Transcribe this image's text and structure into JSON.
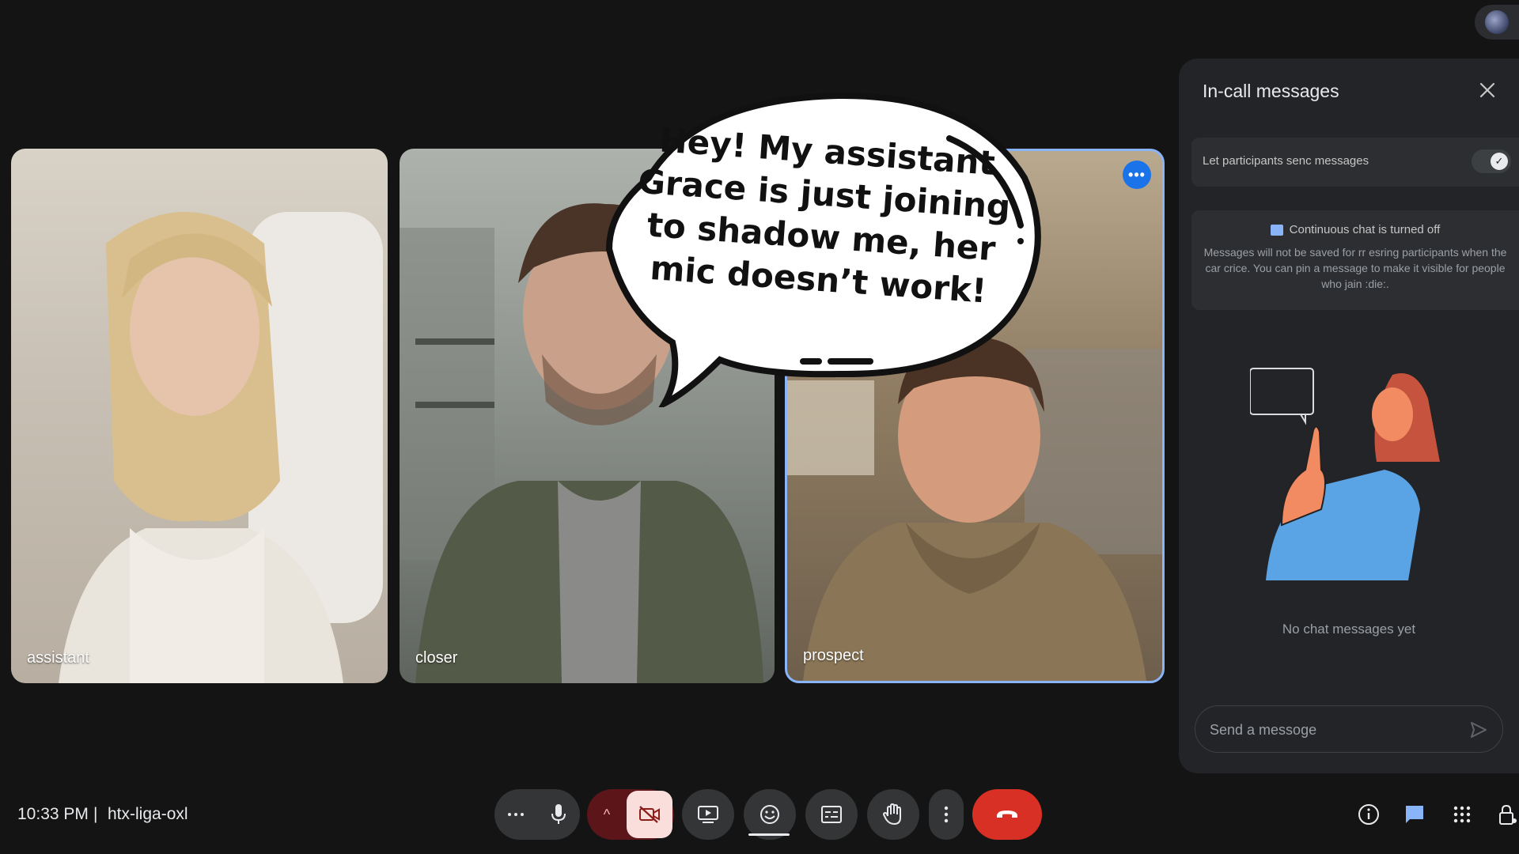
{
  "participants": [
    {
      "name": "assistant"
    },
    {
      "name": "closer"
    },
    {
      "name": "prospect"
    }
  ],
  "speech_bubble": {
    "text": "Hey! My assistant Grace is just joining to shadow me, her mic doesn’t work!"
  },
  "panel": {
    "title": "In-call messages",
    "toggle_label": "Let participants senc messages",
    "toggle_on": true,
    "info_heading": "Continuous chat is turned off",
    "info_body": "Messages will not be saved for rr esring participants when the car crice. You can pin a message to make it visible for people who jain :die:.",
    "empty_text": "No chat messages yet",
    "input_placeholder": "Send a messoge"
  },
  "bottom": {
    "time": "10:33 PM",
    "separator": "|",
    "meeting_code": "htx-liga-oxl"
  },
  "colors": {
    "background": "#141414",
    "panel": "#232427",
    "accent_blue": "#8ab4f8",
    "end_call": "#d93025",
    "camera_off_bg": "#f9dedc"
  },
  "icons": {
    "more_options": "ellipsis-horizontal-icon",
    "mic": "mic-icon",
    "camera_off": "camera-off-icon",
    "present": "present-screen-icon",
    "emoji": "emoji-icon",
    "captions": "captions-icon",
    "raise_hand": "hand-icon",
    "more_vertical": "more-vertical-icon",
    "end_call": "phone-hangup-icon",
    "info": "info-icon",
    "chat": "chat-icon",
    "apps": "apps-grid-icon",
    "host_controls": "lock-person-icon"
  }
}
